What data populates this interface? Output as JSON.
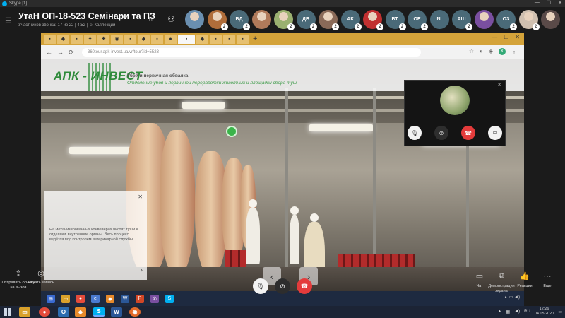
{
  "window": {
    "title": "Skype [1]"
  },
  "call": {
    "title": "УтаН ОП-18-523 Семінари та ПЗ",
    "subtitle": "Участников звонка: 17 из 22 | 4:52 | ☺ Коллекции"
  },
  "participants": [
    {
      "kind": "photo",
      "color": "#6a8fb0",
      "count": ""
    },
    {
      "kind": "photo",
      "color": "#b06d3a",
      "count": "2"
    },
    {
      "kind": "initials",
      "text": "ВД",
      "count": "2"
    },
    {
      "kind": "photo",
      "color": "#b07a5a",
      "count": ""
    },
    {
      "kind": "photo",
      "color": "#9ab070",
      "count": "2"
    },
    {
      "kind": "initials",
      "text": "ДБ",
      "count": "2"
    },
    {
      "kind": "photo",
      "color": "#8a6a58",
      "count": "2"
    },
    {
      "kind": "initials",
      "text": "АК",
      "count": "2"
    },
    {
      "kind": "photo",
      "color": "#c03030",
      "count": "2"
    },
    {
      "kind": "initials",
      "text": "ВТ",
      "count": "2"
    },
    {
      "kind": "initials",
      "text": "ОЕ",
      "count": "2"
    },
    {
      "kind": "initials",
      "text": "NI",
      "count": ""
    },
    {
      "kind": "initials",
      "text": "АШ",
      "count": "2"
    },
    {
      "kind": "photo",
      "color": "#7a4fa0",
      "count": ""
    },
    {
      "kind": "initials",
      "text": "ОЗ",
      "count": "2"
    },
    {
      "kind": "photo",
      "color": "#d0c0b0",
      "count": "2"
    },
    {
      "kind": "photo",
      "color": "#5a4a48",
      "count": ""
    }
  ],
  "browser": {
    "url": "360tour.apk-invest.ua/vr/tour?id=5523",
    "tabs": [
      "▪",
      "◆",
      "▪",
      "✦",
      "✚",
      "◉",
      "▪",
      "◆",
      "▪",
      "●",
      "▪",
      "◆",
      "▪",
      "▪",
      "▪"
    ],
    "profile": "К"
  },
  "tour": {
    "logo": "АПК - ИНВЕСТ",
    "title": "Убой и первичная обвалка",
    "subtitle": "Отделение убоя и первичной переработки животных и площадки сбора туш",
    "info_text": "На механизированных конвейерах чистят туши и отделяют внутренние органы. Весь процесс ведётся под контролем ветеринарной службы."
  },
  "controls": {
    "share_link": "Отправить ссылку на вызов",
    "record": "Начать запись",
    "chat": "Чат",
    "screen": "Демонстрация экрана",
    "react": "Реакции",
    "more": "Еще"
  },
  "taskbar": {
    "lang": "RU",
    "time": "12:26",
    "date": "04.05.2020"
  },
  "colors": {
    "accent": "#00aff0",
    "end_call": "#e43b3b",
    "brand_green": "#2e8a3a"
  }
}
